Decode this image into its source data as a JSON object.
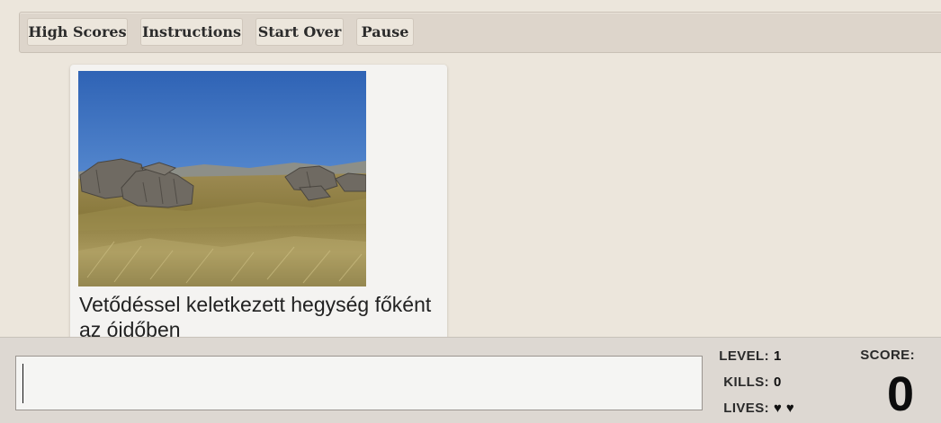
{
  "toolbar": {
    "high_scores": "High Scores",
    "instructions": "Instructions",
    "start_over": "Start Over",
    "pause": "Pause"
  },
  "card": {
    "image_subject": "rocky grassland mountain plateau under blue sky",
    "caption": "Vetődéssel keletkezett hegység főként az óidőben"
  },
  "answer": {
    "value": ""
  },
  "stats": {
    "level_label": "LEVEL:",
    "level": "1",
    "kills_label": "KILLS:",
    "kills": "0",
    "lives_label": "LIVES:",
    "lives": "♥ ♥",
    "score_label": "SCORE:",
    "score": "0"
  },
  "colors": {
    "page_background": "#ece6dc",
    "toolbar_background": "#ddd5cb",
    "bottom_bar_background": "#ddd8d2",
    "card_background": "#f4f3f1"
  }
}
